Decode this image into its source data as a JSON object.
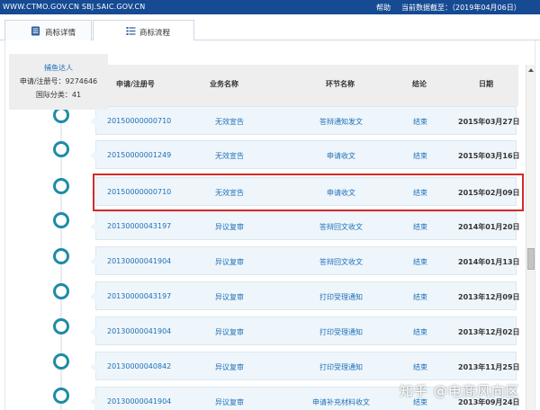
{
  "topbar": {
    "site": "WWW.CTMO.GOV.CN SBJ.SAIC.GOV.CN",
    "help": "帮助",
    "data_date": "当前数据截至：（2019年04月06日）"
  },
  "tabs": [
    {
      "label": "商标详情",
      "icon": "document-icon"
    },
    {
      "label": "商标流程",
      "icon": "list-icon"
    }
  ],
  "card": {
    "name": "捕鱼达人",
    "reg": "申请/注册号：9274646",
    "class": "国际分类：41"
  },
  "table": {
    "headers": [
      "申请/注册号",
      "业务名称",
      "环节名称",
      "结论",
      "日期"
    ],
    "rows": [
      {
        "app": "20150000000710",
        "biz": "无效宣告",
        "step": "答辩通知发文",
        "result": "结束",
        "date": "2015年03月27日"
      },
      {
        "app": "20150000001249",
        "biz": "无效宣告",
        "step": "申请收文",
        "result": "结束",
        "date": "2015年03月16日"
      },
      {
        "app": "20150000000710",
        "biz": "无效宣告",
        "step": "申请收文",
        "result": "结束",
        "date": "2015年02月09日"
      },
      {
        "app": "20130000043197",
        "biz": "异议复审",
        "step": "答辩回文收文",
        "result": "结束",
        "date": "2014年01月20日"
      },
      {
        "app": "20130000041904",
        "biz": "异议复审",
        "step": "答辩回文收文",
        "result": "结束",
        "date": "2014年01月13日"
      },
      {
        "app": "20130000043197",
        "biz": "异议复审",
        "step": "打印受理通知",
        "result": "结束",
        "date": "2013年12月09日"
      },
      {
        "app": "20130000041904",
        "biz": "异议复审",
        "step": "打印受理通知",
        "result": "结束",
        "date": "2013年12月02日"
      },
      {
        "app": "20130000040842",
        "biz": "异议复审",
        "step": "打印受理通知",
        "result": "结束",
        "date": "2013年11月25日"
      },
      {
        "app": "20130000041904",
        "biz": "异议复审",
        "step": "申请补充材料收文",
        "result": "结束",
        "date": "2013年09月24日"
      }
    ]
  },
  "watermark": "知乎 @电商风向区",
  "colors": {
    "topbar": "#164a93",
    "link": "#1f6fb8",
    "timeline": "#1d8ba8",
    "highlight": "#d42a2a",
    "row_bg": "#eef6fb"
  }
}
